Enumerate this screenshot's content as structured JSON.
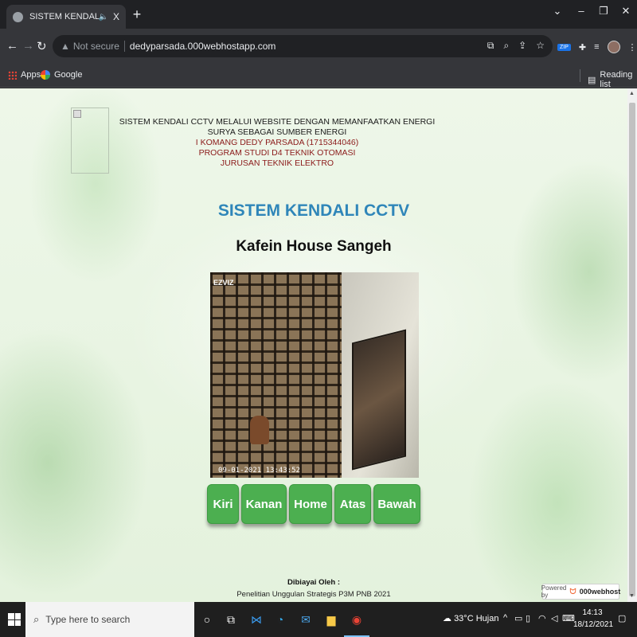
{
  "browser": {
    "tab_title": "SISTEM KENDALI CCTV",
    "audio_icon": "speaker-icon",
    "close_glyph": "X",
    "new_tab_glyph": "+",
    "security_label": "Not secure",
    "url": "dedyparsada.000webhostapp.com",
    "bookmarks": [
      {
        "label": "Apps",
        "icon": "apps-icon"
      },
      {
        "label": "Google",
        "icon": "google-icon"
      }
    ],
    "reading_list_label": "Reading list",
    "ext_zip_label": "ZIP"
  },
  "page": {
    "header": {
      "line1": "SISTEM KENDALI CCTV MELALUI WEBSITE DENGAN MEMANFAATKAN ENERGI SURYA SEBAGAI SUMBER ENERGI",
      "line2": "I KOMANG DEDY PARSADA (1715344046)",
      "line3": "PROGRAM STUDI D4 TEKNIK OTOMASI",
      "line4": "JURUSAN TEKNIK ELEKTRO"
    },
    "title": "SISTEM KENDALI CCTV",
    "subtitle": "Kafein House Sangeh",
    "camera": {
      "brand": "EZVIZ",
      "timestamp": "09-01-2021 13:43:52"
    },
    "controls": [
      {
        "label": "Kiri",
        "name": "kiri-button"
      },
      {
        "label": "Kanan",
        "name": "kanan-button"
      },
      {
        "label": "Home",
        "name": "home-button"
      },
      {
        "label": "Atas",
        "name": "atas-button"
      },
      {
        "label": "Bawah",
        "name": "bawah-button"
      }
    ],
    "footer": {
      "label": "Dibiayai Oleh :",
      "text": "Penelitian Unggulan Strategis P3M PNB 2021"
    },
    "powered_by": {
      "prefix": "Powered by",
      "brand": "000webhost"
    }
  },
  "taskbar": {
    "search_placeholder": "Type here to search",
    "weather": "33°C  Hujan",
    "time": "14:13",
    "date": "18/12/2021"
  },
  "colors": {
    "title_blue": "#2f86b9",
    "button_green": "#4caf50",
    "header_red": "#8b1a1a"
  }
}
